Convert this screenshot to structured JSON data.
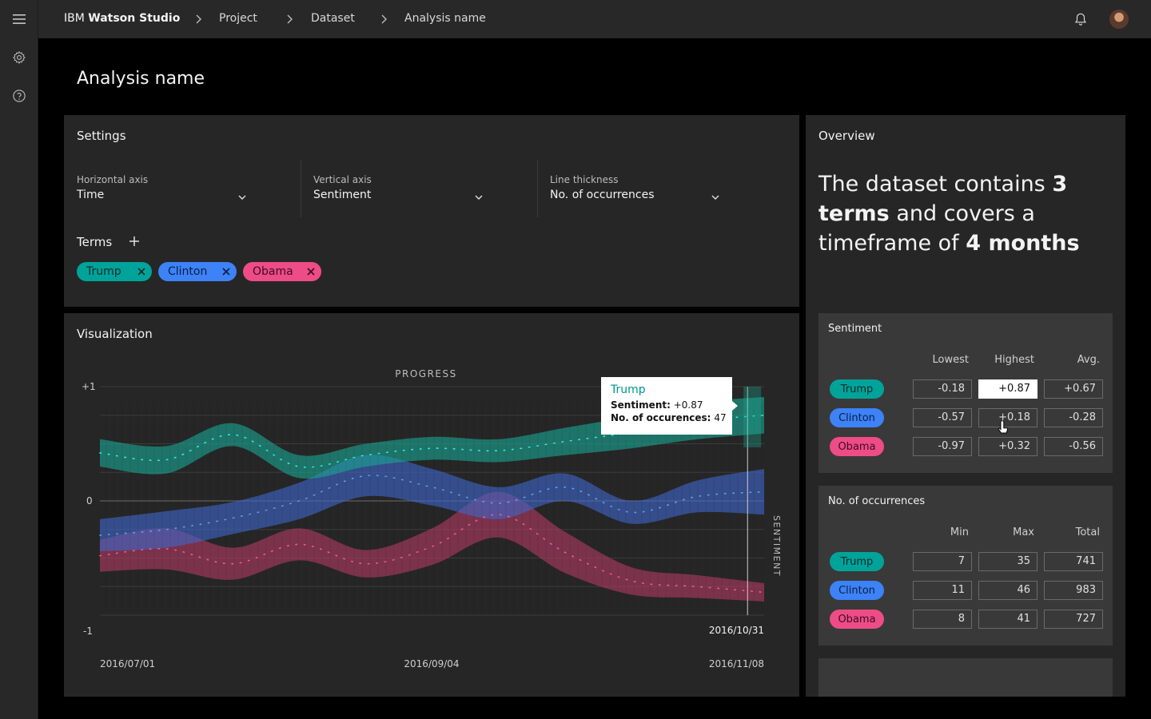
{
  "header": {
    "brand_prefix": "IBM",
    "brand_name": "Watson Studio",
    "breadcrumbs": [
      "Project",
      "Dataset",
      "Analysis name"
    ]
  },
  "page": {
    "title": "Analysis name"
  },
  "settings": {
    "title": "Settings",
    "fields": [
      {
        "label": "Horizontal axis",
        "value": "Time"
      },
      {
        "label": "Vertical axis",
        "value": "Sentiment"
      },
      {
        "label": "Line thickness",
        "value": "No. of occurrences"
      }
    ],
    "terms_label": "Terms",
    "terms": [
      "Trump",
      "Clinton",
      "Obama"
    ]
  },
  "visualization": {
    "title": "Visualization",
    "tooltip": {
      "title": "Trump",
      "sentiment_label": "Sentiment:",
      "sentiment_value": "+0.87",
      "occ_label": "No. of occurences:",
      "occ_value": "47"
    }
  },
  "chart_data": {
    "type": "area",
    "title": "PROGRESS",
    "ylabel": "SENTIMENT",
    "xlabel": "",
    "ylim": [
      -1,
      1
    ],
    "y_ticks": [
      "+1",
      "0",
      "-1"
    ],
    "x_tick_labels": [
      "2016/07/01",
      "2016/09/04",
      "2016/11/08"
    ],
    "cursor_label": "2016/10/31",
    "x": [
      0,
      0.1,
      0.2,
      0.3,
      0.4,
      0.5,
      0.6,
      0.7,
      0.8,
      0.9,
      1.0
    ],
    "series": [
      {
        "name": "Trump",
        "color": "#1aa592",
        "values": [
          0.42,
          0.36,
          0.58,
          0.3,
          0.4,
          0.46,
          0.44,
          0.52,
          0.6,
          0.7,
          0.75
        ],
        "thickness": [
          0.12,
          0.12,
          0.1,
          0.1,
          0.1,
          0.1,
          0.1,
          0.12,
          0.14,
          0.16,
          0.16
        ]
      },
      {
        "name": "Clinton",
        "color": "#3f66c8",
        "values": [
          -0.3,
          -0.25,
          -0.15,
          0.0,
          0.22,
          0.12,
          -0.02,
          0.12,
          -0.1,
          0.04,
          0.08
        ],
        "thickness": [
          0.14,
          0.16,
          0.14,
          0.16,
          0.18,
          0.16,
          0.14,
          0.12,
          0.1,
          0.14,
          0.2
        ]
      },
      {
        "name": "Obama",
        "color": "#b03a62",
        "values": [
          -0.48,
          -0.42,
          -0.55,
          -0.38,
          -0.55,
          -0.4,
          -0.12,
          -0.45,
          -0.7,
          -0.75,
          -0.8
        ],
        "thickness": [
          0.14,
          0.18,
          0.14,
          0.14,
          0.12,
          0.16,
          0.2,
          0.18,
          0.12,
          0.1,
          0.08
        ]
      }
    ],
    "grid": true
  },
  "overview": {
    "title": "Overview",
    "text_1": "The dataset contains ",
    "text_2": "3 terms",
    "text_3": " and covers a timeframe of ",
    "text_4": "4 months"
  },
  "sentiment_table": {
    "title": "Sentiment",
    "columns": [
      "Lowest",
      "Highest",
      "Avg."
    ],
    "rows": [
      {
        "term": "Trump",
        "values": [
          "-0.18",
          "+0.87",
          "+0.67"
        ]
      },
      {
        "term": "Clinton",
        "values": [
          "-0.57",
          "+0.18",
          "-0.28"
        ]
      },
      {
        "term": "Obama",
        "values": [
          "-0.97",
          "+0.32",
          "-0.56"
        ]
      }
    ]
  },
  "occurrences_table": {
    "title": "No. of occurrences",
    "columns": [
      "Min",
      "Max",
      "Total"
    ],
    "rows": [
      {
        "term": "Trump",
        "values": [
          "7",
          "35",
          "741"
        ]
      },
      {
        "term": "Clinton",
        "values": [
          "11",
          "46",
          "983"
        ]
      },
      {
        "term": "Obama",
        "values": [
          "8",
          "41",
          "727"
        ]
      }
    ]
  },
  "icons": {
    "menu": "hamburger-menu-icon",
    "settings": "gear-icon",
    "help": "help-icon",
    "notifications": "bell-icon",
    "user": "avatar"
  }
}
